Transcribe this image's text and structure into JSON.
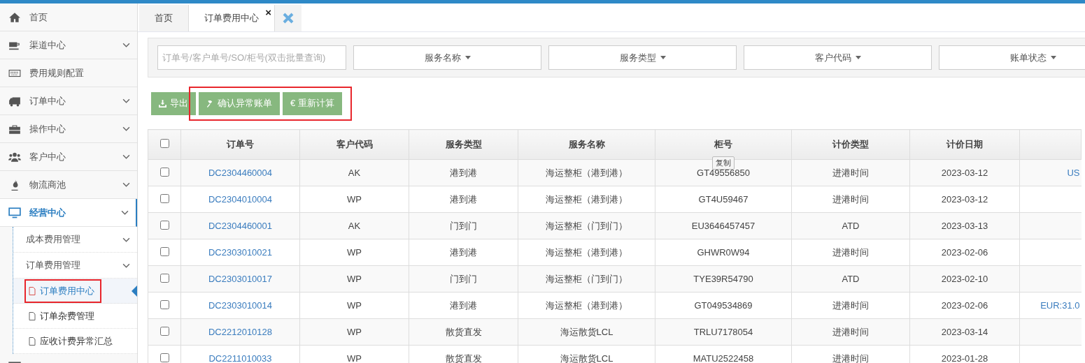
{
  "sidebar": {
    "items": [
      {
        "label": "首页",
        "expandable": false,
        "active": false
      },
      {
        "label": "渠道中心",
        "expandable": true,
        "active": false
      },
      {
        "label": "费用规则配置",
        "expandable": false,
        "active": false
      },
      {
        "label": "订单中心",
        "expandable": true,
        "active": false
      },
      {
        "label": "操作中心",
        "expandable": true,
        "active": false
      },
      {
        "label": "客户中心",
        "expandable": true,
        "active": false
      },
      {
        "label": "物流商池",
        "expandable": true,
        "active": false
      },
      {
        "label": "经营中心",
        "expandable": true,
        "active": true,
        "children": [
          {
            "label": "成本费用管理"
          },
          {
            "label": "订单费用管理",
            "children": [
              {
                "label": "订单费用中心",
                "selected": true,
                "highlighted": true
              },
              {
                "label": "订单杂费管理",
                "selected": false,
                "highlighted": false
              },
              {
                "label": "应收计费异常汇总",
                "selected": false,
                "highlighted": false
              }
            ]
          }
        ]
      }
    ]
  },
  "tabs": [
    {
      "label": "首页",
      "selected": false
    },
    {
      "label": "订单费用中心",
      "selected": true,
      "close": "×"
    }
  ],
  "filters": {
    "search": {
      "placeholder": "订单号/客户单号/SO/柜号(双击批量查询)"
    },
    "dropdowns": [
      "服务名称",
      "服务类型",
      "客户代码",
      "账单状态"
    ]
  },
  "toolbar": [
    {
      "label": "导出",
      "highlighted": false
    },
    {
      "label": "确认异常账单",
      "highlighted": true
    },
    {
      "label": "€ 重新计算",
      "highlighted": true
    }
  ],
  "table": {
    "columns": [
      "订单号",
      "客户代码",
      "服务类型",
      "服务名称",
      "柜号",
      "计价类型",
      "计价日期"
    ],
    "select_all_checked": false,
    "rows": [
      {
        "checked": false,
        "cells": [
          "DC2304460004",
          "AK",
          "港到港",
          "海运整柜（港到港）",
          "GT49556850",
          "进港时间",
          "2023-03-12"
        ],
        "column_9": "US",
        "tooltip": "复制"
      },
      {
        "checked": false,
        "cells": [
          "DC2304010004",
          "WP",
          "港到港",
          "海运整柜（港到港）",
          "GT4U59467",
          "进港时间",
          "2023-03-12"
        ]
      },
      {
        "checked": false,
        "cells": [
          "DC2304460001",
          "AK",
          "门到门",
          "海运整柜（门到门）",
          "EU3646457457",
          "ATD",
          "2023-03-13"
        ]
      },
      {
        "checked": false,
        "cells": [
          "DC2303010021",
          "WP",
          "港到港",
          "海运整柜（港到港）",
          "GHWR0W94",
          "进港时间",
          "2023-02-06"
        ]
      },
      {
        "checked": false,
        "cells": [
          "DC2303010017",
          "WP",
          "门到门",
          "海运整柜（门到门）",
          "TYE39R54790",
          "ATD",
          "2023-02-10"
        ]
      },
      {
        "checked": false,
        "cells": [
          "DC2303010014",
          "WP",
          "港到港",
          "海运整柜（港到港）",
          "GT049534869",
          "进港时间",
          "2023-02-06"
        ],
        "column_9": "EUR:31.0"
      },
      {
        "checked": false,
        "cells": [
          "DC2212010128",
          "WP",
          "散货直发",
          "海运散货LCL",
          "TRLU7178054",
          "进港时间",
          "2023-03-14"
        ]
      },
      {
        "checked": false,
        "cells": [
          "DC2211010033",
          "WP",
          "散货直发",
          "海运散货LCL",
          "MATU2522458",
          "进港时间",
          "2023-01-28"
        ]
      }
    ]
  }
}
